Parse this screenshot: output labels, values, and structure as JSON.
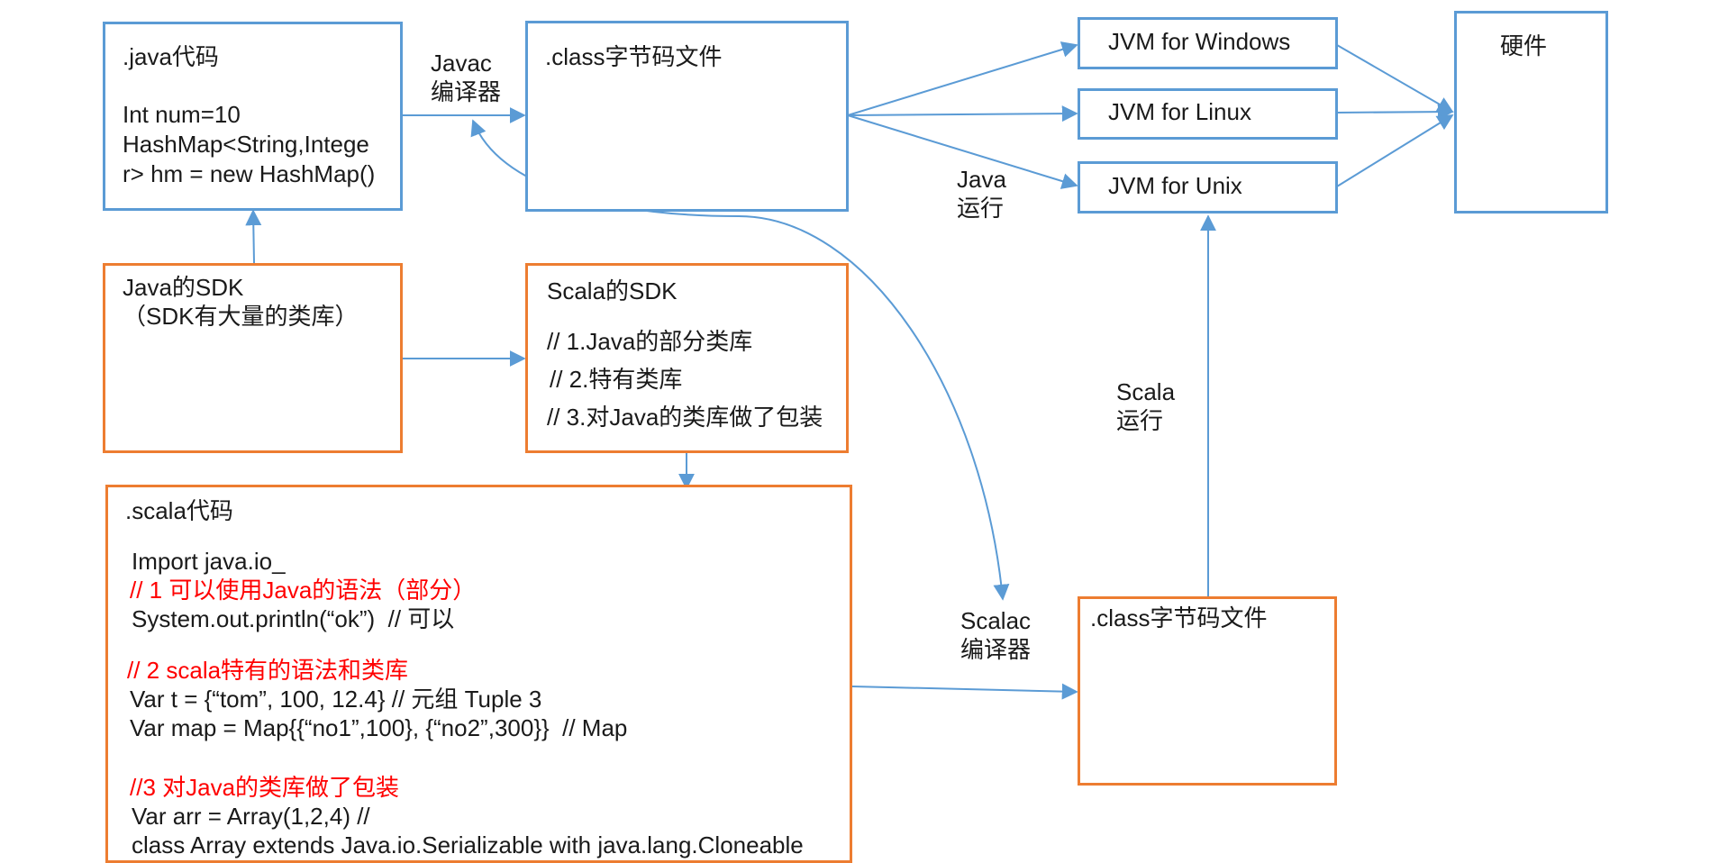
{
  "java_code": {
    "title": ".java代码",
    "lines": [
      "Int num=10",
      "HashMap<String,Intege",
      "r> hm = new HashMap()"
    ]
  },
  "javac_label": [
    "Javac",
    "编译器"
  ],
  "class_file_top": {
    "title": ".class字节码文件"
  },
  "jvms": [
    "JVM for Windows",
    "JVM for Linux",
    "JVM for Unix"
  ],
  "java_run_label": [
    "Java",
    "运行"
  ],
  "hardware": {
    "title": "硬件"
  },
  "java_sdk": {
    "lines": [
      "Java的SDK",
      "（SDK有大量的类库）"
    ]
  },
  "scala_sdk": {
    "title": "Scala的SDK",
    "lines": [
      "// 1.Java的部分类库",
      "// 2.特有类库",
      "// 3.对Java的类库做了包装"
    ]
  },
  "scala_run_label": [
    "Scala",
    "运行"
  ],
  "scala_code": {
    "title": ".scala代码",
    "import_line": "Import java.io_",
    "comment1": "// 1 可以使用Java的语法（部分）",
    "line1": "System.out.println(“ok”)  // 可以",
    "comment2": "// 2 scala特有的语法和类库",
    "line2": "Var t = {“tom”, 100, 12.4} // 元组 Tuple 3",
    "line3": "Var map = Map{{“no1”,100}, {“no2”,300}}  // Map",
    "comment3": "//3 对Java的类库做了包装",
    "line4": "Var arr = Array(1,2,4) //",
    "line5": "class Array extends Java.io.Serializable with java.lang.Cloneable"
  },
  "scalac_label": [
    "Scalac",
    "编译器"
  ],
  "class_file_bottom": {
    "title": ".class字节码文件"
  },
  "colors": {
    "blue_border": "#5b9bd5",
    "orange_border": "#ed7d31",
    "arrow": "#5b9bd5",
    "comment_red": "#ff0000"
  }
}
